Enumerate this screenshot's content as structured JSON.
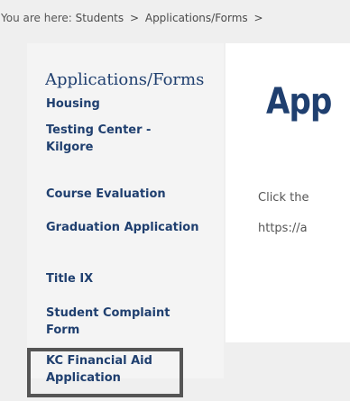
{
  "breadcrumb": {
    "prefix": "You are here:",
    "items": [
      "Students",
      "Applications/Forms"
    ],
    "separator": ">"
  },
  "sidebar": {
    "title": "Applications/Forms",
    "items": [
      {
        "label": "Housing"
      },
      {
        "label": "Testing Center - Kilgore"
      },
      {
        "label": "Course Evaluation"
      },
      {
        "label": "Graduation Application"
      },
      {
        "label": "Title IX"
      },
      {
        "label": "Student Complaint Form"
      },
      {
        "label": "KC Financial Aid Application"
      }
    ]
  },
  "main": {
    "title": "App",
    "line1": "Click the",
    "line2": "https://a"
  },
  "colors": {
    "accent": "#1f3f6f",
    "highlight_border": "#555555"
  }
}
